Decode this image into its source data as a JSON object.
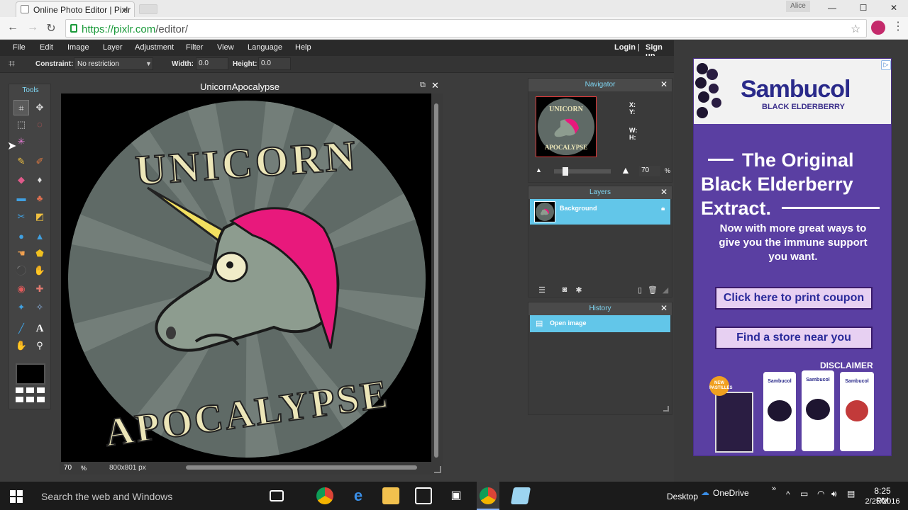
{
  "browser": {
    "tab_title": "Online Photo Editor | Pixlr",
    "tab_close": "×",
    "user_badge": "Alice",
    "win_min": "—",
    "win_max": "☐",
    "win_close": "✕",
    "url_host": "https://pixlr.com",
    "url_path": "/editor/"
  },
  "menubar": {
    "items": [
      "File",
      "Edit",
      "Image",
      "Layer",
      "Adjustment",
      "Filter",
      "View",
      "Language",
      "Help"
    ],
    "login": "Login",
    "separator": "|",
    "signup": "Sign up"
  },
  "options": {
    "constraint_label": "Constraint:",
    "constraint_value": "No restriction",
    "width_label": "Width:",
    "width_value": "0.0",
    "height_label": "Height:",
    "height_value": "0.0"
  },
  "tools": {
    "title": "Tools"
  },
  "document": {
    "title": "UnicornApocalypse",
    "zoom": "70",
    "zoom_unit": "%",
    "dimensions": "800x801 px",
    "logo_top": "UNICORN",
    "logo_bottom": "APOCALYPSE"
  },
  "navigator": {
    "title": "Navigator",
    "x_label": "X:",
    "y_label": "Y:",
    "w_label": "W:",
    "h_label": "H:",
    "zoom": "70",
    "zoom_unit": "%",
    "thumb_top": "UNICORN",
    "thumb_bottom": "APOCALYPSE"
  },
  "layers": {
    "title": "Layers",
    "items": [
      {
        "name": "Background",
        "locked": true
      }
    ]
  },
  "history": {
    "title": "History",
    "items": [
      "Open image"
    ]
  },
  "ad": {
    "brand": "Sambucol",
    "brand_sub": "BLACK ELDERBERRY",
    "headline": "The Original Black Elderberry Extract.",
    "subtext": "Now with more great ways to give you the immune support you want.",
    "button_coupon": "Click here to print coupon",
    "button_store": "Find a store near you",
    "disclaimer": "DISCLAIMER",
    "choices": "▷",
    "new_badge": "NEW PASTILLES",
    "product_label": "Sambucol"
  },
  "taskbar": {
    "search": "Search the web and Windows",
    "desktop": "Desktop",
    "onedrive": "OneDrive",
    "time": "8:25 PM",
    "date": "2/25/2016"
  },
  "colors": {
    "accent": "#62c6e9",
    "panel_title": "#7fd6f3",
    "ad_purple": "#5a3fa2",
    "url_green": "#1a9a3a"
  }
}
